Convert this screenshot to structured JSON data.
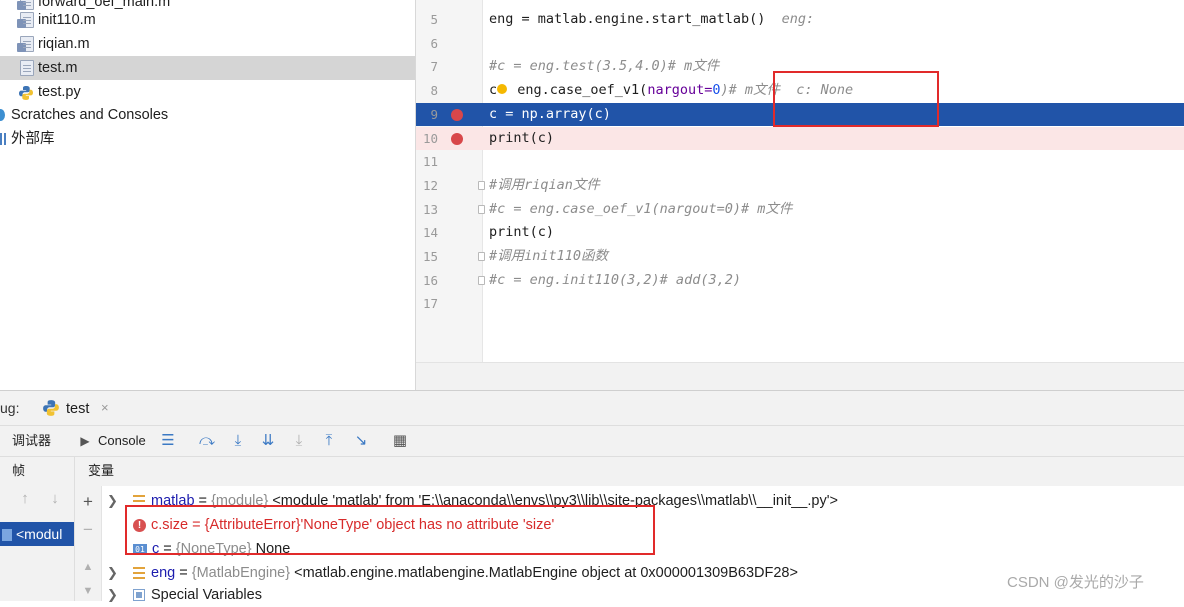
{
  "project_tree": {
    "items": [
      {
        "label": "forward_oef_main.m",
        "icon": "matlab-file-icon"
      },
      {
        "label": "init110.m",
        "icon": "matlab-file-icon"
      },
      {
        "label": "riqian.m",
        "icon": "matlab-file-icon"
      },
      {
        "label": "test.m",
        "icon": "text-file-icon",
        "selected": true
      },
      {
        "label": "test.py",
        "icon": "python-file-icon"
      },
      {
        "label": "Scratches and Consoles",
        "icon": "scratches-icon"
      },
      {
        "label": "外部库",
        "icon": "library-icon"
      }
    ]
  },
  "editor": {
    "lines": [
      {
        "num": "5",
        "code": "eng = matlab.engine.start_matlab()",
        "inline": "eng:"
      },
      {
        "num": "6",
        "code": ""
      },
      {
        "num": "7",
        "code": "#c = eng.test(3.5,4.0)# m文件"
      },
      {
        "num": "8",
        "code_pre": "c",
        "code_mid": " eng.case_oef_v1(",
        "code_param": "nargout=",
        "code_num": "0",
        "code_post": ")# m文件",
        "inline": "c: None"
      },
      {
        "num": "9",
        "code": "c = np.array(c)"
      },
      {
        "num": "10",
        "code": "print(c)"
      },
      {
        "num": "11",
        "code": ""
      },
      {
        "num": "12",
        "code": "#调用riqian文件"
      },
      {
        "num": "13",
        "code": "#c = eng.case_oef_v1(nargout=0)# m文件"
      },
      {
        "num": "14",
        "code": "print(c)"
      },
      {
        "num": "15",
        "code": "#调用init110函数"
      },
      {
        "num": "16",
        "code": "#c = eng.init110(3,2)# add(3,2)"
      },
      {
        "num": "17",
        "code": ""
      }
    ]
  },
  "debug": {
    "label": "ug:",
    "tab_label": "test",
    "close_glyph": "×",
    "toolbar": {
      "debugger_label": "调试器",
      "console_label": "Console"
    },
    "frames_header": "帧",
    "variables_header": "变量",
    "frame_selected": "<modul",
    "variables": [
      {
        "name": "matlab",
        "eq": " = ",
        "type": "{module}",
        "value": " <module 'matlab' from 'E:\\\\anaconda\\\\envs\\\\py3\\\\lib\\\\site-packages\\\\matlab\\\\__init__.py'>"
      },
      {
        "name": "c.size",
        "eq": " = ",
        "type": "{AttributeError}",
        "value": "'NoneType' object has no attribute 'size'"
      },
      {
        "name": "c",
        "eq": " = ",
        "type": "{NoneType}",
        "value": " None"
      },
      {
        "name": "eng",
        "eq": " = ",
        "type": "{MatlabEngine}",
        "value": " <matlab.engine.matlabengine.MatlabEngine object at 0x000001309B63DF28>"
      },
      {
        "name": "Special Variables",
        "eq": "",
        "type": "",
        "value": ""
      }
    ]
  },
  "watermark": "CSDN @发光的沙子",
  "colors": {
    "highlight_line": "#2154a8",
    "breakpoint": "#d8474a",
    "annotation_box": "#e12a2a",
    "error_text": "#d72b2b"
  }
}
